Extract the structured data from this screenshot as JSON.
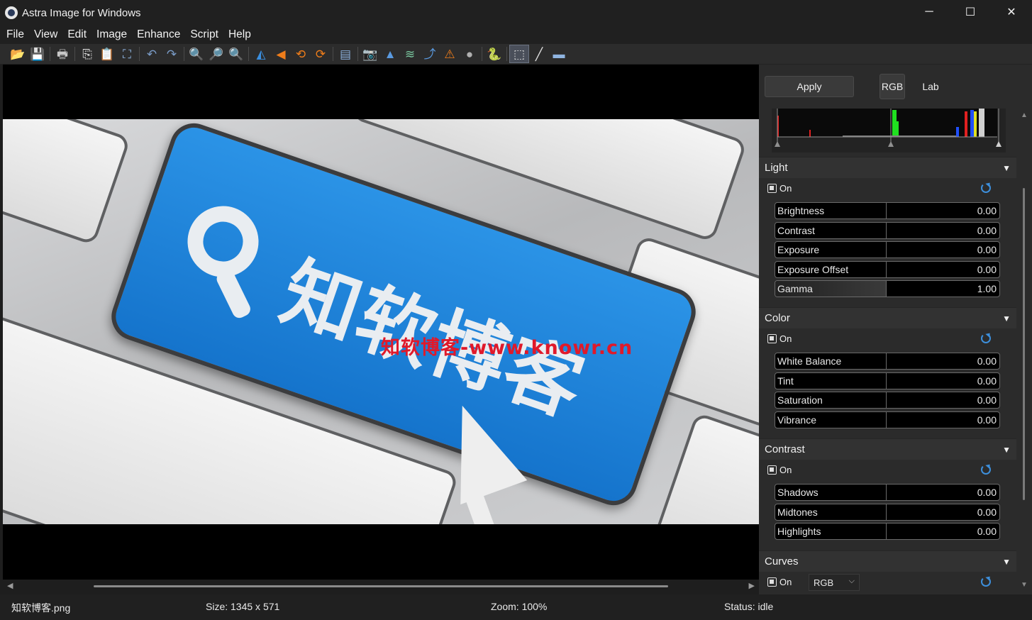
{
  "window": {
    "title": "Astra Image for Windows",
    "minimize": "─",
    "maximize": "☐",
    "close": "✕"
  },
  "menu": [
    "File",
    "View",
    "Edit",
    "Image",
    "Enhance",
    "Script",
    "Help"
  ],
  "toolbar": [
    {
      "icon": "open-folder-icon",
      "glyph": "📂"
    },
    {
      "icon": "save-icon",
      "glyph": "💾"
    },
    {
      "sep": true
    },
    {
      "icon": "print-icon",
      "glyph": "🖶"
    },
    {
      "sep": true
    },
    {
      "icon": "copy-icon",
      "glyph": "⎘"
    },
    {
      "icon": "paste-icon",
      "glyph": "📋"
    },
    {
      "icon": "crop-icon",
      "glyph": "⛶"
    },
    {
      "sep": true
    },
    {
      "icon": "undo-icon",
      "glyph": "↶"
    },
    {
      "icon": "redo-icon",
      "glyph": "↷"
    },
    {
      "sep": true
    },
    {
      "icon": "zoom-in-icon",
      "glyph": "🔍"
    },
    {
      "icon": "zoom-out-icon",
      "glyph": "🔎"
    },
    {
      "icon": "zoom-fit-icon",
      "glyph": "🔍"
    },
    {
      "sep": true
    },
    {
      "icon": "flip-horizontal-icon",
      "glyph": "◭"
    },
    {
      "icon": "flip-vertical-icon",
      "glyph": "◀"
    },
    {
      "icon": "rotate-left-icon",
      "glyph": "⟲"
    },
    {
      "icon": "rotate-right-icon",
      "glyph": "⟳"
    },
    {
      "sep": true
    },
    {
      "icon": "split-view-icon",
      "glyph": "▤"
    },
    {
      "sep": true
    },
    {
      "icon": "camera-icon",
      "glyph": "📷"
    },
    {
      "icon": "sharpen-icon",
      "glyph": "▲"
    },
    {
      "icon": "layers-icon",
      "glyph": "≋"
    },
    {
      "icon": "curve-icon",
      "glyph": "⤴"
    },
    {
      "icon": "warning-icon",
      "glyph": "⚠"
    },
    {
      "icon": "noise-icon",
      "glyph": "●"
    },
    {
      "sep": true
    },
    {
      "icon": "python-icon",
      "glyph": "🐍"
    },
    {
      "sep": true
    },
    {
      "icon": "select-rect-icon",
      "glyph": "⬚",
      "active": true
    },
    {
      "icon": "line-tool-icon",
      "glyph": "╱"
    },
    {
      "icon": "minus-tool-icon",
      "glyph": "▬"
    }
  ],
  "canvas": {
    "key_text": "知软博客",
    "watermark": "知软博客-www.knowr.cn"
  },
  "panel": {
    "apply_label": "Apply",
    "mode_rgb": "RGB",
    "mode_lab": "Lab",
    "on_label": "On",
    "sections": {
      "light": {
        "title": "Light",
        "sliders": [
          {
            "label": "Brightness",
            "value": "0.00"
          },
          {
            "label": "Contrast",
            "value": "0.00"
          },
          {
            "label": "Exposure",
            "value": "0.00"
          },
          {
            "label": "Exposure Offset",
            "value": "0.00"
          },
          {
            "label": "Gamma",
            "value": "1.00"
          }
        ]
      },
      "color": {
        "title": "Color",
        "sliders": [
          {
            "label": "White Balance",
            "value": "0.00"
          },
          {
            "label": "Tint",
            "value": "0.00"
          },
          {
            "label": "Saturation",
            "value": "0.00"
          },
          {
            "label": "Vibrance",
            "value": "0.00"
          }
        ]
      },
      "contrast": {
        "title": "Contrast",
        "sliders": [
          {
            "label": "Shadows",
            "value": "0.00"
          },
          {
            "label": "Midtones",
            "value": "0.00"
          },
          {
            "label": "Highlights",
            "value": "0.00"
          }
        ]
      },
      "curves": {
        "title": "Curves",
        "channel": "RGB"
      }
    }
  },
  "status": {
    "filename": "知软博客.png",
    "size": "Size: 1345 x 571",
    "zoom": "Zoom: 100%",
    "state": "Status: idle"
  },
  "colors": {
    "accent": "#3d8fdb",
    "watermark": "#e0192a",
    "key_blue": "#1f86dc"
  }
}
